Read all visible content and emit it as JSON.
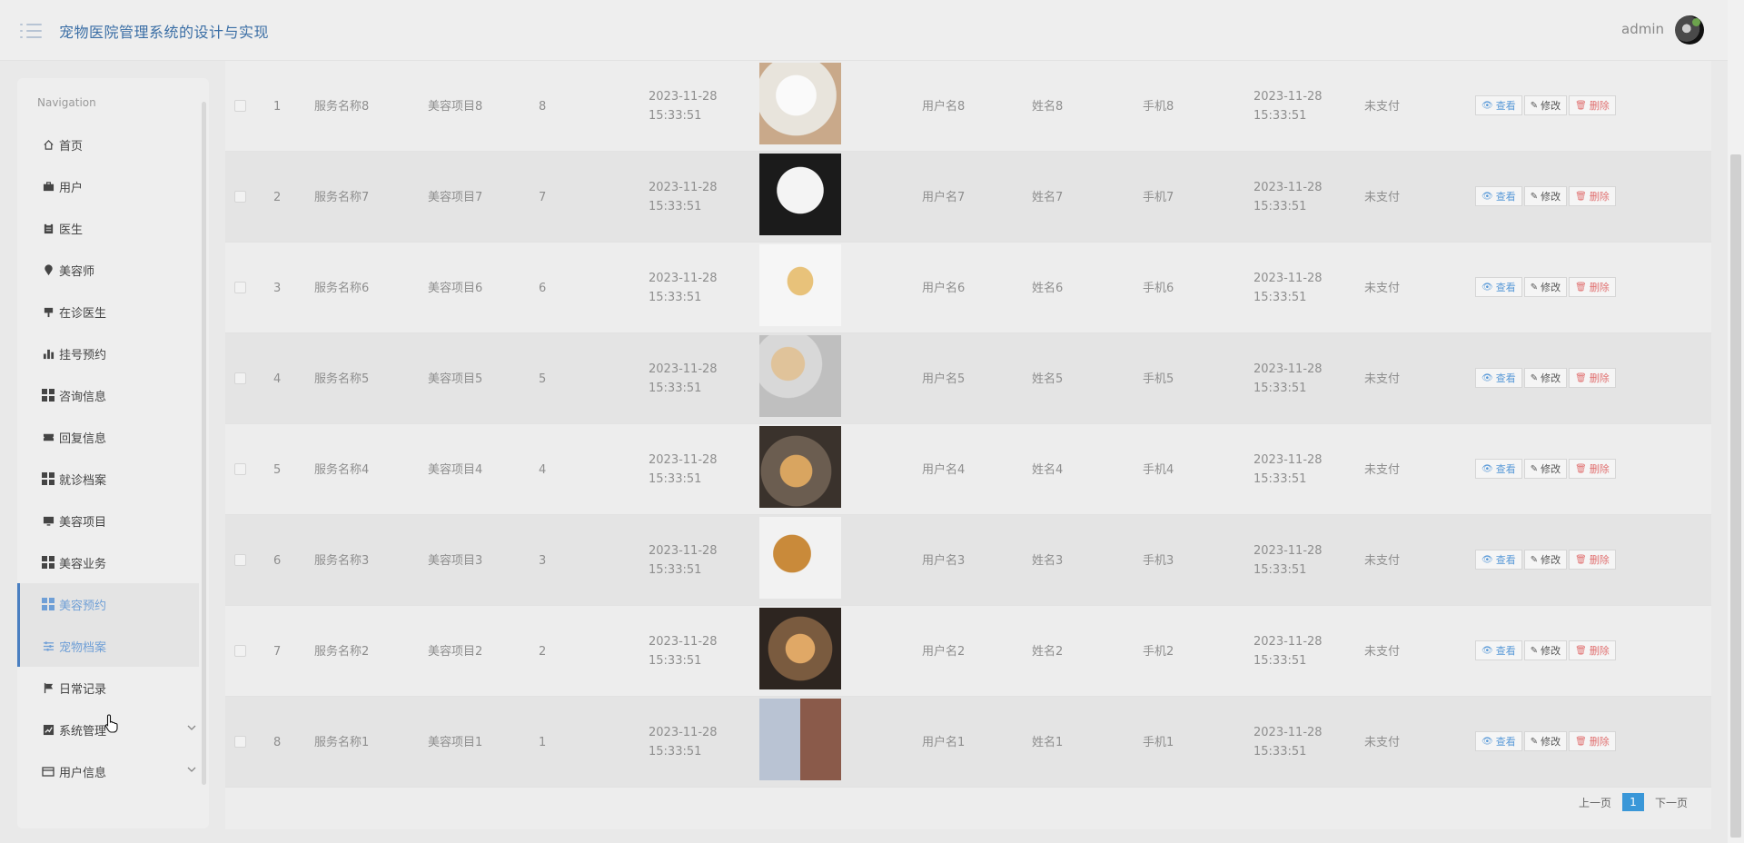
{
  "header": {
    "title": "宠物医院管理系统的设计与实现",
    "user": "admin"
  },
  "sidebar": {
    "title": "Navigation",
    "items": [
      {
        "label": "首页",
        "icon": "home-icon"
      },
      {
        "label": "用户",
        "icon": "briefcase-icon"
      },
      {
        "label": "医生",
        "icon": "clipboard-icon"
      },
      {
        "label": "美容师",
        "icon": "location-icon"
      },
      {
        "label": "在诊医生",
        "icon": "signpost-icon"
      },
      {
        "label": "挂号预约",
        "icon": "bar-chart-icon"
      },
      {
        "label": "咨询信息",
        "icon": "grid-icon"
      },
      {
        "label": "回复信息",
        "icon": "ticket-icon"
      },
      {
        "label": "就诊档案",
        "icon": "grid-icon"
      },
      {
        "label": "美容项目",
        "icon": "monitor-icon"
      },
      {
        "label": "美容业务",
        "icon": "grid-icon"
      },
      {
        "label": "美容预约",
        "icon": "grid-icon"
      },
      {
        "label": "宠物档案",
        "icon": "sliders-icon"
      },
      {
        "label": "日常记录",
        "icon": "flag-icon"
      },
      {
        "label": "系统管理",
        "icon": "line-chart-icon"
      },
      {
        "label": "用户信息",
        "icon": "card-icon"
      }
    ]
  },
  "buttons": {
    "view": "查看",
    "edit": "修改",
    "delete": "删除"
  },
  "rows": [
    {
      "idx": "1",
      "service": "服务名称8",
      "project": "美容项目8",
      "num": "8",
      "time1": "2023-11-28 15:33:51",
      "user": "用户名8",
      "name": "姓名8",
      "phone": "手机8",
      "time2": "2023-11-28 15:33:51",
      "status": "未支付"
    },
    {
      "idx": "2",
      "service": "服务名称7",
      "project": "美容项目7",
      "num": "7",
      "time1": "2023-11-28 15:33:51",
      "user": "用户名7",
      "name": "姓名7",
      "phone": "手机7",
      "time2": "2023-11-28 15:33:51",
      "status": "未支付"
    },
    {
      "idx": "3",
      "service": "服务名称6",
      "project": "美容项目6",
      "num": "6",
      "time1": "2023-11-28 15:33:51",
      "user": "用户名6",
      "name": "姓名6",
      "phone": "手机6",
      "time2": "2023-11-28 15:33:51",
      "status": "未支付"
    },
    {
      "idx": "4",
      "service": "服务名称5",
      "project": "美容项目5",
      "num": "5",
      "time1": "2023-11-28 15:33:51",
      "user": "用户名5",
      "name": "姓名5",
      "phone": "手机5",
      "time2": "2023-11-28 15:33:51",
      "status": "未支付"
    },
    {
      "idx": "5",
      "service": "服务名称4",
      "project": "美容项目4",
      "num": "4",
      "time1": "2023-11-28 15:33:51",
      "user": "用户名4",
      "name": "姓名4",
      "phone": "手机4",
      "time2": "2023-11-28 15:33:51",
      "status": "未支付"
    },
    {
      "idx": "6",
      "service": "服务名称3",
      "project": "美容项目3",
      "num": "3",
      "time1": "2023-11-28 15:33:51",
      "user": "用户名3",
      "name": "姓名3",
      "phone": "手机3",
      "time2": "2023-11-28 15:33:51",
      "status": "未支付"
    },
    {
      "idx": "7",
      "service": "服务名称2",
      "project": "美容项目2",
      "num": "2",
      "time1": "2023-11-28 15:33:51",
      "user": "用户名2",
      "name": "姓名2",
      "phone": "手机2",
      "time2": "2023-11-28 15:33:51",
      "status": "未支付"
    },
    {
      "idx": "8",
      "service": "服务名称1",
      "project": "美容项目1",
      "num": "1",
      "time1": "2023-11-28 15:33:51",
      "user": "用户名1",
      "name": "姓名1",
      "phone": "手机1",
      "time2": "2023-11-28 15:33:51",
      "status": "未支付"
    }
  ],
  "pagination": {
    "prev": "上一页",
    "current": "1",
    "next": "下一页"
  }
}
